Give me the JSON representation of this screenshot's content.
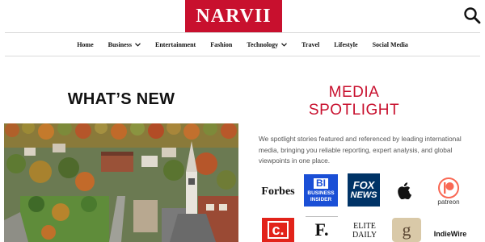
{
  "header": {
    "brand": "NARVII",
    "search_icon": "search-icon"
  },
  "nav": {
    "items": [
      {
        "label": "Home"
      },
      {
        "label": "Business",
        "has_dropdown": true
      },
      {
        "label": "Entertainment"
      },
      {
        "label": "Fashion"
      },
      {
        "label": "Technology",
        "has_dropdown": true
      },
      {
        "label": "Travel"
      },
      {
        "label": "Lifestyle"
      },
      {
        "label": "Social Media"
      }
    ]
  },
  "whats_new": {
    "heading": "WHAT’S NEW",
    "image_alt_icon": "town-aerial-photo"
  },
  "media_spotlight": {
    "title_line1": "MEDIA",
    "title_line2": "SPOTLIGHT",
    "description": "We spotlight stories featured and referenced by leading international media, bringing you reliable reporting, expert analysis, and global viewpoints in one place.",
    "logos_row1": [
      {
        "name": "Forbes",
        "text": "Forbes"
      },
      {
        "name": "Business Insider",
        "text_main": "BI",
        "text_sub1": "BUSINESS",
        "text_sub2": "INSIDER"
      },
      {
        "name": "Fox News",
        "text_top": "FOX",
        "text_bottom": "NEWS"
      },
      {
        "name": "Apple",
        "icon": "apple-icon"
      },
      {
        "name": "Patreon",
        "text": "patreon"
      }
    ],
    "logos_row2": [
      {
        "name": "CNET",
        "text": "c."
      },
      {
        "name": "Forbes F",
        "text": "F."
      },
      {
        "name": "Elite Daily",
        "text_top": "ELITE",
        "text_bottom": "DAILY"
      },
      {
        "name": "Goodreads",
        "text": "g"
      },
      {
        "name": "IndieWire",
        "text": "IndieWire"
      }
    ]
  },
  "colors": {
    "brand_red": "#c8102e",
    "business_insider_blue": "#1a4fd6",
    "fox_blue": "#003366",
    "patreon_orange": "#f96854",
    "cnet_red": "#e2231a"
  }
}
